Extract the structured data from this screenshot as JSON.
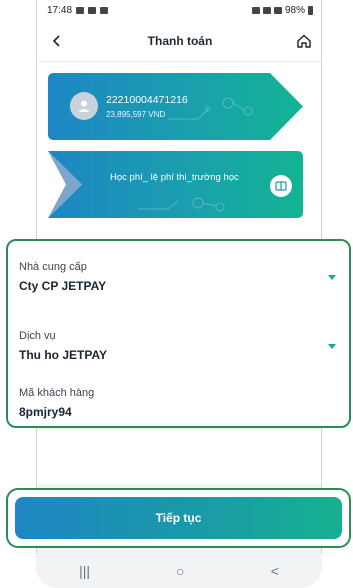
{
  "status_bar": {
    "time": "17:48",
    "battery": "98%"
  },
  "header": {
    "title": "Thanh toán"
  },
  "account_card": {
    "account_number": "22210004471216",
    "balance": "23,895,597 VND"
  },
  "fee_card": {
    "label": "Học phí_ lệ phí thi_trường học"
  },
  "form": {
    "provider_label": "Nhà cung cấp",
    "provider_value": "Cty CP JETPAY",
    "service_label": "Dịch vụ",
    "service_value": "Thu ho JETPAY",
    "customer_code_label": "Mã khách hàng",
    "customer_code_value": "8pmjry94"
  },
  "actions": {
    "continue_label": "Tiếp tục"
  },
  "nav": {
    "recent": "|||",
    "home": "○",
    "back": "<"
  },
  "colors": {
    "accent": "#1a9aa8",
    "highlight_border": "#2e8b57",
    "card_blue": "#1e86c4",
    "card_teal": "#16b08f"
  }
}
